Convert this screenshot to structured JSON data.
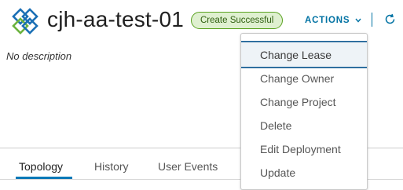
{
  "deployment": {
    "title": "cjh-aa-test-01",
    "status": "Create Successful",
    "description": "No description"
  },
  "toolbar": {
    "actions_label": "ACTIONS",
    "chevron_icon": "chevron-down-icon",
    "refresh_icon": "refresh-icon"
  },
  "tabs": [
    {
      "label": "Topology",
      "active": true
    },
    {
      "label": "History",
      "active": false
    },
    {
      "label": "User Events",
      "active": false
    }
  ],
  "actions_menu": [
    {
      "label": "Change Lease",
      "highlighted": true
    },
    {
      "label": "Change Owner"
    },
    {
      "label": "Change Project"
    },
    {
      "label": "Delete"
    },
    {
      "label": "Edit Deployment"
    },
    {
      "label": "Update"
    }
  ],
  "colors": {
    "accent": "#0072a3",
    "badge_border": "#5aa220",
    "badge_bg": "#dff0d0",
    "logo_blue": "#1a6fb5",
    "logo_green": "#6cb33f"
  }
}
